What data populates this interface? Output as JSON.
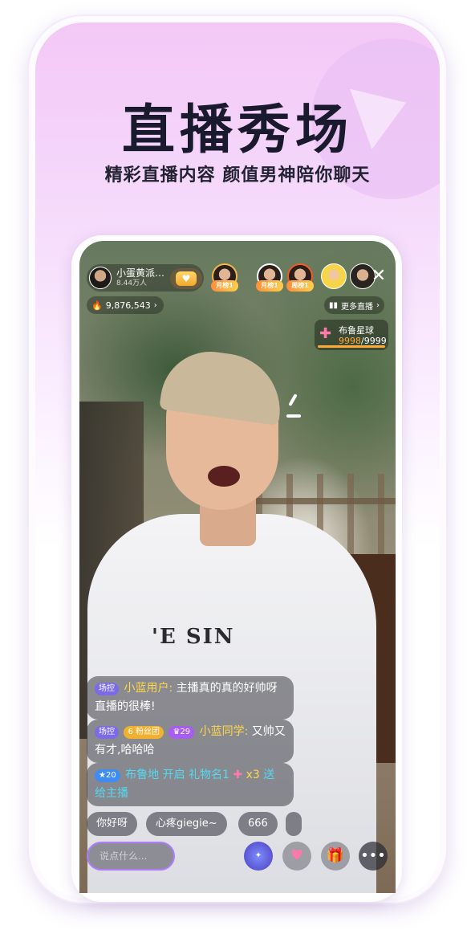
{
  "hero": {
    "title": "直播秀场",
    "subtitle": "精彩直播内容 颜值男神陪你聊天"
  },
  "host": {
    "name": "小蛋黄派…",
    "fans": "8.44万人"
  },
  "ranks": [
    {
      "tag": "月榜1"
    },
    {
      "tag": "月榜1"
    },
    {
      "tag": "周榜1"
    }
  ],
  "heat": {
    "value": "9,876,543",
    "chevron": "›"
  },
  "more_live": {
    "label": "更多直播",
    "chevron": "›"
  },
  "planet": {
    "name": "布鲁星球",
    "current": "9998",
    "total": "/9999"
  },
  "shirt_text": "'E SIN",
  "chat": [
    {
      "badges": [
        "场控"
      ],
      "nick": "小蓝用户:",
      "text": " 主播真的真的好帅呀直播的很棒!"
    },
    {
      "badges": [
        "场控",
        "粉丝团",
        "29"
      ],
      "fans_level": "6",
      "nick": "小蓝同学:",
      "text": " 又帅又有才,哈哈哈"
    },
    {
      "badges": [
        "20"
      ],
      "nick": "布鲁地",
      "action": " 开启 ",
      "gift": "礼物名1",
      "count": " x3 ",
      "text": "送给主播"
    }
  ],
  "quick_replies": [
    "你好呀",
    "心疼giegie~",
    "666"
  ],
  "input": {
    "placeholder": "说点什么..."
  },
  "actions": [
    "lucky-icon",
    "heart-hands-icon",
    "gift-icon",
    "more-icon"
  ],
  "colors": {
    "accent_purple": "#b07cff",
    "gold": "#ffd84a",
    "fire": "#ff5a2a"
  }
}
